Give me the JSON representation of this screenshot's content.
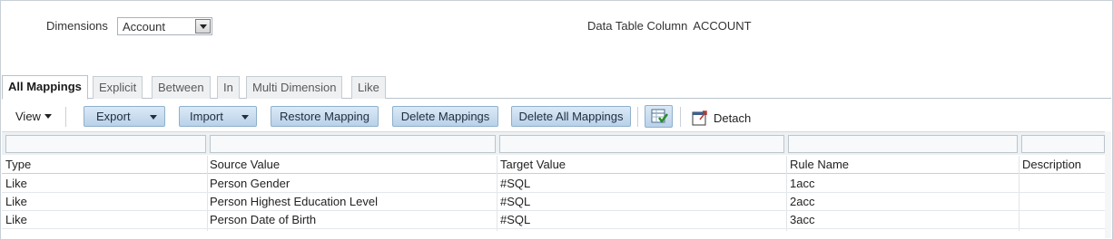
{
  "filters": {
    "dimensions_label": "Dimensions",
    "dimensions_value": "Account",
    "data_table_column_label": "Data Table Column",
    "data_table_column_value": "ACCOUNT"
  },
  "tabs": [
    {
      "label": "All Mappings",
      "active": true
    },
    {
      "label": "Explicit",
      "active": false
    },
    {
      "label": "Between",
      "active": false
    },
    {
      "label": "In",
      "active": false
    },
    {
      "label": "Multi Dimension",
      "active": false
    },
    {
      "label": "Like",
      "active": false
    }
  ],
  "toolbar": {
    "view_label": "View",
    "export_label": "Export",
    "import_label": "Import",
    "restore_label": "Restore Mapping",
    "delete_label": "Delete Mappings",
    "delete_all_label": "Delete All Mappings",
    "export_icon": "export-to-excel-icon",
    "detach_label": "Detach",
    "detach_icon": "detach-window-icon"
  },
  "table": {
    "columns": [
      "Type",
      "Source Value",
      "Target Value",
      "Rule Name",
      "Description"
    ],
    "rows": [
      [
        "Like",
        "Person Gender",
        "#SQL",
        "1acc",
        ""
      ],
      [
        "Like",
        "Person Highest Education Level",
        "#SQL",
        "2acc",
        ""
      ],
      [
        "Like",
        "Person Date of Birth",
        "#SQL",
        "3acc",
        ""
      ]
    ]
  },
  "colors": {
    "button_fill": "#c6dbef",
    "button_border": "#8fb0cc",
    "border": "#c9d0d6"
  }
}
